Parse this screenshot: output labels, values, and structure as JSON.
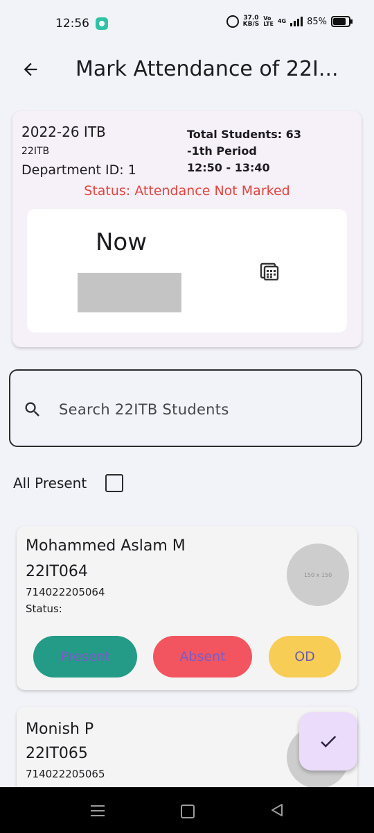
{
  "status_bar": {
    "time": "12:56",
    "speed_value": "37.0",
    "speed_unit": "KB/S",
    "volte": "Vo",
    "lte": "LTE",
    "network": "4G",
    "battery": "85%"
  },
  "appbar": {
    "title": "Mark Attendance of 22I..."
  },
  "class_info": {
    "batch": "2022-26 ITB",
    "code": "22ITB",
    "department": "Department ID: 1",
    "total_students": "Total Students: 63",
    "period": "-1th Period",
    "time": "12:50 - 13:40",
    "status": "Status: Attendance Not Marked",
    "date_label": "Now"
  },
  "search": {
    "placeholder": "Search 22ITB Students"
  },
  "all_present": {
    "label": "All Present",
    "checked": false
  },
  "students": [
    {
      "name": "Mohammed Aslam M",
      "roll": "22IT064",
      "register_no": "714022205064",
      "status": "Status:",
      "avatar_text": "150 x 150",
      "buttons": {
        "present": "Present",
        "absent": "Absent",
        "od": "OD"
      }
    },
    {
      "name": "Monish P",
      "roll": "22IT065",
      "register_no": "714022205065"
    }
  ],
  "colors": {
    "present": "#239b87",
    "absent": "#f2555f",
    "od": "#f7cd55",
    "status_alert": "#e0463f",
    "fab": "#ebdcfb"
  },
  "icons": [
    "back-arrow-icon",
    "calendar-icon",
    "search-icon",
    "check-icon"
  ]
}
